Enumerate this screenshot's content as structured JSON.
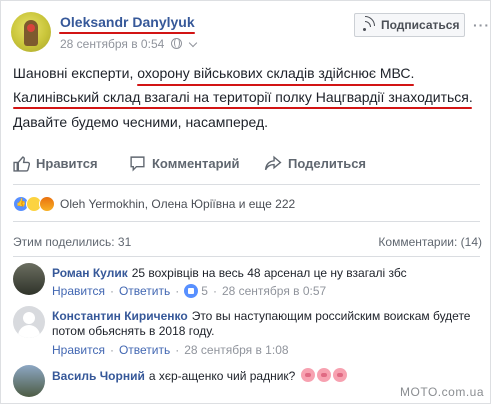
{
  "post": {
    "author": "Oleksandr Danylyuk",
    "time": "28 сентября в 0:54",
    "subscribe_label": "Подписаться",
    "more": "···",
    "lines": [
      "Шановні експерти, охорону військових складів здійснює МВС.",
      "Калинівський склад взагалі на території полку Нацгвардії знаходиться.",
      "Давайте будемо чесними, насамперед."
    ]
  },
  "actions": {
    "like": "Нравится",
    "comment": "Комментарий",
    "share": "Поделиться"
  },
  "reactions": {
    "names": "Oleh Yermokhin, Олена Юріївна и еще 222",
    "shares": "Этим поделились: 31",
    "comments": "Комментарии: (14)"
  },
  "comments": [
    {
      "author": "Роман Кулик",
      "text": "25 вохрівців на весь 48 арсенал це ну взагалі збс",
      "like": "Нравится",
      "reply": "Ответить",
      "likes": "5",
      "time": "28 сентября в 0:57"
    },
    {
      "author": "Константин Кириченко",
      "text": "Это вы наступающим российским воискам будете",
      "text2": "потом обьяснять в 2018 году.",
      "like": "Нравится",
      "reply": "Ответить",
      "time": "28 сентября в 1:08"
    },
    {
      "author": "Василь Чорний",
      "text": "а хєр-ащенко чий радник?"
    }
  ],
  "watermark": "MOTO.com.ua",
  "colors": {
    "link": "#365899",
    "annotation": "#d21414",
    "like_blue": "#5890ff"
  }
}
